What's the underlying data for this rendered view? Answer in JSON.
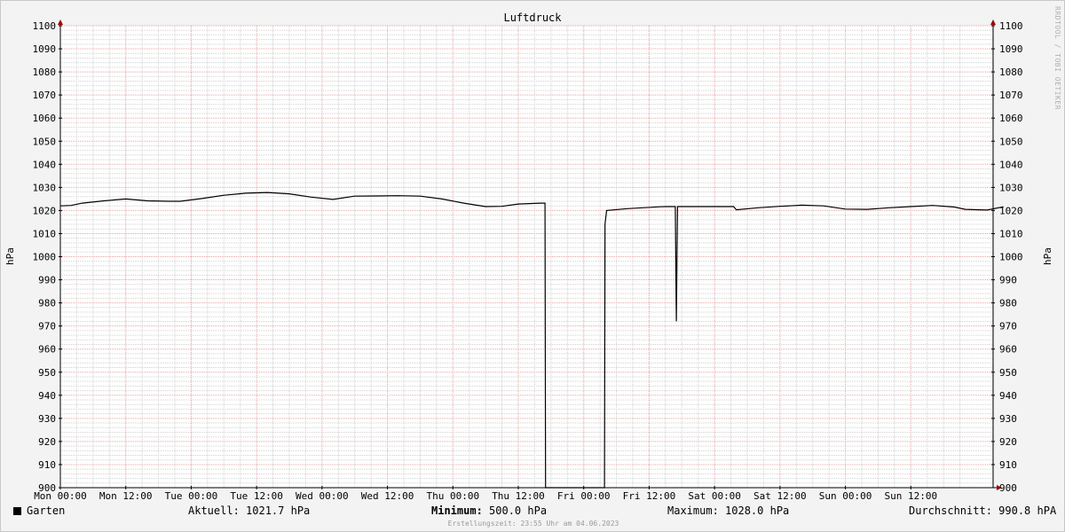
{
  "chart_data": {
    "type": "line",
    "title": "Luftdruck",
    "ylabel": "hPa",
    "ylim": [
      900,
      1100
    ],
    "y_ticks": [
      900,
      910,
      920,
      930,
      940,
      950,
      960,
      970,
      980,
      990,
      1000,
      1010,
      1020,
      1030,
      1040,
      1050,
      1060,
      1070,
      1080,
      1090,
      1100
    ],
    "x_tick_labels": [
      "Mon 00:00",
      "Mon 12:00",
      "Tue 00:00",
      "Tue 12:00",
      "Wed 00:00",
      "Wed 12:00",
      "Thu 00:00",
      "Thu 12:00",
      "Fri 00:00",
      "Fri 12:00",
      "Sat 00:00",
      "Sat 12:00",
      "Sun 00:00",
      "Sun 12:00"
    ],
    "x_range_hours": [
      0,
      168
    ],
    "grid": true,
    "series": [
      {
        "name": "Garten",
        "color": "#000000",
        "points": [
          [
            0,
            1022.0
          ],
          [
            2,
            1022.2
          ],
          [
            4,
            1023.2
          ],
          [
            8,
            1024.2
          ],
          [
            12,
            1025.0
          ],
          [
            16,
            1024.2
          ],
          [
            20,
            1024.0
          ],
          [
            22,
            1024.0
          ],
          [
            26,
            1025.2
          ],
          [
            30,
            1026.6
          ],
          [
            34,
            1027.5
          ],
          [
            38,
            1027.8
          ],
          [
            42,
            1027.2
          ],
          [
            46,
            1025.8
          ],
          [
            50,
            1024.8
          ],
          [
            54,
            1026.2
          ],
          [
            58,
            1026.3
          ],
          [
            62,
            1026.4
          ],
          [
            66,
            1026.2
          ],
          [
            70,
            1025.0
          ],
          [
            74,
            1023.2
          ],
          [
            78,
            1021.7
          ],
          [
            81,
            1021.8
          ],
          [
            84,
            1022.8
          ],
          [
            88,
            1023.2
          ],
          [
            88.9,
            1023.2
          ],
          [
            89.0,
            900
          ],
          [
            99.8,
            900
          ],
          [
            99.9,
            1014.0
          ],
          [
            100.2,
            1020.0
          ],
          [
            104,
            1020.8
          ],
          [
            110,
            1021.6
          ],
          [
            111.4,
            1021.7
          ],
          [
            112.8,
            1021.7
          ],
          [
            113.0,
            972.0
          ],
          [
            113.2,
            1021.7
          ],
          [
            123.5,
            1021.7
          ],
          [
            124.0,
            1020.3
          ],
          [
            128,
            1021.2
          ],
          [
            132,
            1021.8
          ],
          [
            136,
            1022.3
          ],
          [
            140,
            1022.0
          ],
          [
            144,
            1020.6
          ],
          [
            148,
            1020.5
          ],
          [
            152,
            1021.2
          ],
          [
            156,
            1021.7
          ],
          [
            160,
            1022.2
          ],
          [
            164,
            1021.5
          ],
          [
            166,
            1020.5
          ],
          [
            170,
            1020.2
          ],
          [
            173,
            1021.6
          ]
        ]
      }
    ],
    "legend": {
      "label": "Garten",
      "placement": "bottom-left"
    }
  },
  "stats": {
    "current": "Aktuell: 1021.7 hPa",
    "minimum_label": "Minimum:",
    "minimum_value": " 500.0 hPa",
    "maximum": "Maximum: 1028.0 hPa",
    "average": "Durchschnitt: 990.8 hPA"
  },
  "created": "Erstellungszeit: 23:55 Uhr am 04.06.2023",
  "watermark": "RRDTOOL / TOBI OETIKER",
  "colors": {
    "background": "#f3f3f3",
    "plot_background": "#ffffff",
    "major_grid": "#e8a0a0",
    "minor_grid": "#d0d0d0",
    "axis": "#000000",
    "arrow": "#a00000"
  }
}
